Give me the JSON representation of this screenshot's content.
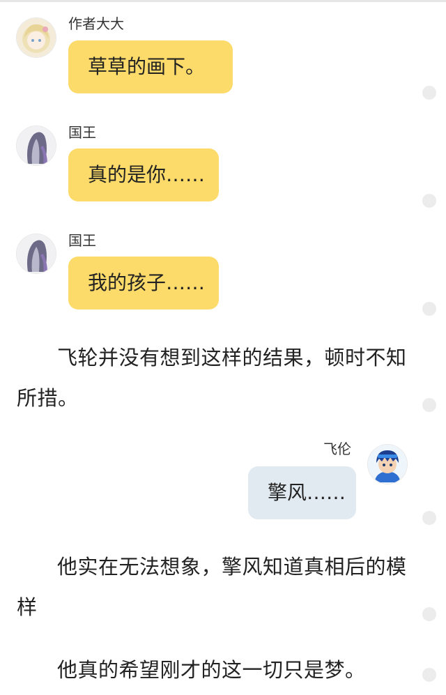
{
  "messages": [
    {
      "speaker": "作者大大",
      "text": "草草的画下。",
      "avatar": "blonde-girl-avatar",
      "side": "left",
      "color": "#fcdb6a"
    },
    {
      "speaker": "国王",
      "text": "真的是你……",
      "avatar": "purple-hair-avatar",
      "side": "left",
      "color": "#fcdb6a"
    },
    {
      "speaker": "国王",
      "text": "我的孩子……",
      "avatar": "purple-hair-avatar",
      "side": "left",
      "color": "#fcdb6a"
    },
    {
      "speaker": "飞伦",
      "text": "擎风……",
      "avatar": "blue-boy-avatar",
      "side": "right",
      "color": "#e2eaf1"
    }
  ],
  "paragraphs": [
    "飞轮并没有想到这样的结果，顿时不知所措。",
    "他实在无法想象，擎风知道真相后的模样",
    "他真的希望刚才的这一切只是梦。"
  ],
  "scrollbar": {
    "dot_icon": "circle-dot-icon",
    "dot_color": "#ececec"
  }
}
